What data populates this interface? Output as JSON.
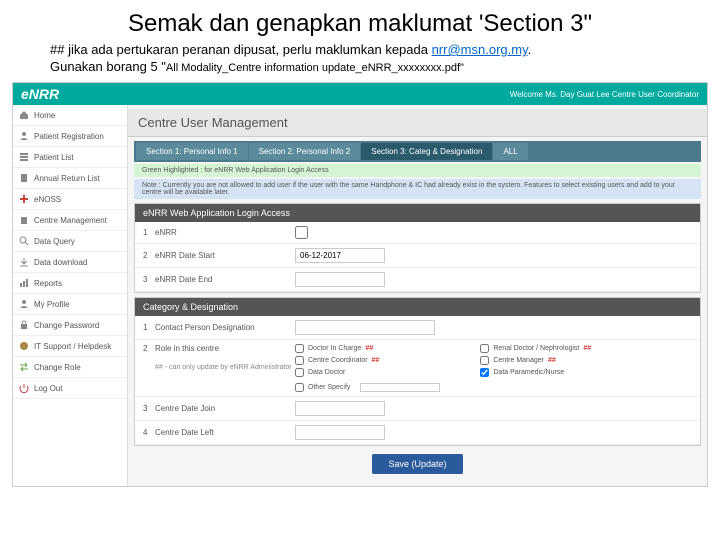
{
  "slide": {
    "title": "Semak dan genapkan maklumat 'Section 3\"",
    "note_prefix": "## jika ada pertukaran peranan dipusat, perlu maklumkan kepada ",
    "note_email": "nrr@msn.org.my",
    "note_suffix": ".",
    "sub_prefix": "Gunakan borang 5 \"",
    "sub_filename": "All Modality_Centre information update_eNRR_xxxxxxxx.pdf\""
  },
  "topbar": {
    "logo_e": "e",
    "logo_nrr": "NRR",
    "welcome": "Welcome Ms. Day Guat Lee    Centre User Coordinator"
  },
  "sidebar": {
    "items": [
      "Home",
      "Patient Registration",
      "Patient List",
      "Annual Return List",
      "eNOSS",
      "Centre Management",
      "Data Query",
      "Data download",
      "Reports",
      "My Profile",
      "Change Password",
      "IT Support / Helpdesk",
      "Change Role",
      "Log Out"
    ]
  },
  "page": {
    "title": "Centre User Management"
  },
  "tabs": {
    "t1": "Section 1: Personal Info 1",
    "t2": "Section 2: Personal Info 2",
    "t3": "Section 3: Categ & Designation",
    "t4": "ALL"
  },
  "notes": {
    "green": "Green Highlighted : for eNRR Web Application Login Access",
    "blue": "Note : Currently you are not allowed to add user if the user with the same Handphone & IC had already exist in the system. Features to select existing users and add to your centre will be available later."
  },
  "loginBox": {
    "header": "eNRR Web Application Login Access",
    "r1_num": "1",
    "r1_label": "eNRR",
    "r2_num": "2",
    "r2_label": "eNRR Date Start",
    "r2_value": "06-12-2017",
    "r3_num": "3",
    "r3_label": "eNRR Date End"
  },
  "categBox": {
    "header": "Category & Designation",
    "r1_num": "1",
    "r1_label": "Contact Person Designation",
    "r2_num": "2",
    "r2_label": "Role in this centre",
    "r2_hint": "## - can only update by eNRR Administrator",
    "checks": {
      "c1": "Doctor In Charge",
      "c1s": "##",
      "c2": "Centre Coordinator",
      "c2s": "##",
      "c3": "Data Doctor",
      "c4": "Renal Doctor / Nephrologist",
      "c4s": "##",
      "c5": "Centre Manager",
      "c5s": "##",
      "c6": "Data Paramedic/Nurse"
    },
    "other_label": "Other Specify",
    "r3_num": "3",
    "r3_label": "Centre Date Join",
    "r4_num": "4",
    "r4_label": "Centre Date Left"
  },
  "save": {
    "label": "Save (Update)"
  }
}
